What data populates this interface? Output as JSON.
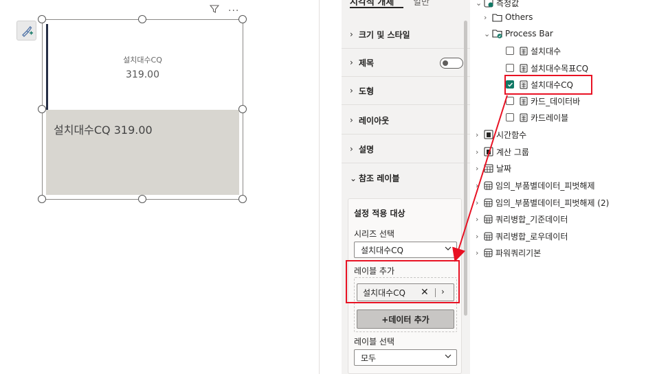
{
  "canvas": {
    "card": {
      "top_label": "설치대수CQ",
      "top_value": "319.00",
      "bar_label": "설치대수CQ 319.00"
    },
    "icons": {
      "format_painter": "brush-plus-icon",
      "filter": "funnel-icon",
      "more": "ellipsis-icon"
    }
  },
  "format_pane": {
    "tabs": [
      "시각적 개체",
      "일반",
      "···"
    ],
    "sections": [
      {
        "label": "크기 및 스타일",
        "expanded": false
      },
      {
        "label": "제목",
        "expanded": false,
        "toggle": "off"
      },
      {
        "label": "도형",
        "expanded": false
      },
      {
        "label": "레이아웃",
        "expanded": false
      },
      {
        "label": "설명",
        "expanded": false
      },
      {
        "label": "참조 레이블",
        "expanded": true
      }
    ],
    "reference_label": {
      "title": "설정 적용 대상",
      "series_label": "시리즈 선택",
      "series_value": "설치대수CQ",
      "add_label": "레이블 추가",
      "pill_value": "설치대수CQ",
      "add_data_button": "+데이터 추가",
      "label_select": "레이블 선택",
      "label_select_value": "모두"
    }
  },
  "data_pane": {
    "rows": [
      {
        "label": "측정값",
        "kind": "measures-folder",
        "level": 0,
        "expanded": true
      },
      {
        "label": "Others",
        "kind": "folder",
        "level": 1,
        "expanded": false
      },
      {
        "label": "Process Bar",
        "kind": "folder-checked",
        "level": 1,
        "expanded": true
      },
      {
        "label": "설치대수",
        "kind": "measure",
        "level": 2,
        "checked": false
      },
      {
        "label": "설치대수목표CQ",
        "kind": "measure",
        "level": 2,
        "checked": false
      },
      {
        "label": "설치대수CQ",
        "kind": "measure",
        "level": 2,
        "checked": true
      },
      {
        "label": "카드_데이터바",
        "kind": "measure",
        "level": 2,
        "checked": false
      },
      {
        "label": "카드레이블",
        "kind": "measure",
        "level": 2,
        "checked": false
      },
      {
        "label": "시간함수",
        "kind": "calc-table",
        "level": 0,
        "expanded": false
      },
      {
        "label": "계산 그룹",
        "kind": "calc-table",
        "level": 0,
        "expanded": false
      },
      {
        "label": "날짜",
        "kind": "date-table",
        "level": 0,
        "expanded": false
      },
      {
        "label": "임의_부품별데이터_피벗해제",
        "kind": "table",
        "level": 0,
        "expanded": false
      },
      {
        "label": "임의_부품별데이터_피벗해제 (2)",
        "kind": "table",
        "level": 0,
        "expanded": false
      },
      {
        "label": "쿼리병합_기준데이터",
        "kind": "table",
        "level": 0,
        "expanded": false
      },
      {
        "label": "쿼리병합_로우데이터",
        "kind": "table",
        "level": 0,
        "expanded": false
      },
      {
        "label": "파워쿼리기본",
        "kind": "table",
        "level": 0,
        "expanded": false
      }
    ]
  },
  "colors": {
    "accent_green": "#117865",
    "highlight_red": "#e81123",
    "bar_fill": "#d8d6d0",
    "card_accent": "#252e45"
  }
}
